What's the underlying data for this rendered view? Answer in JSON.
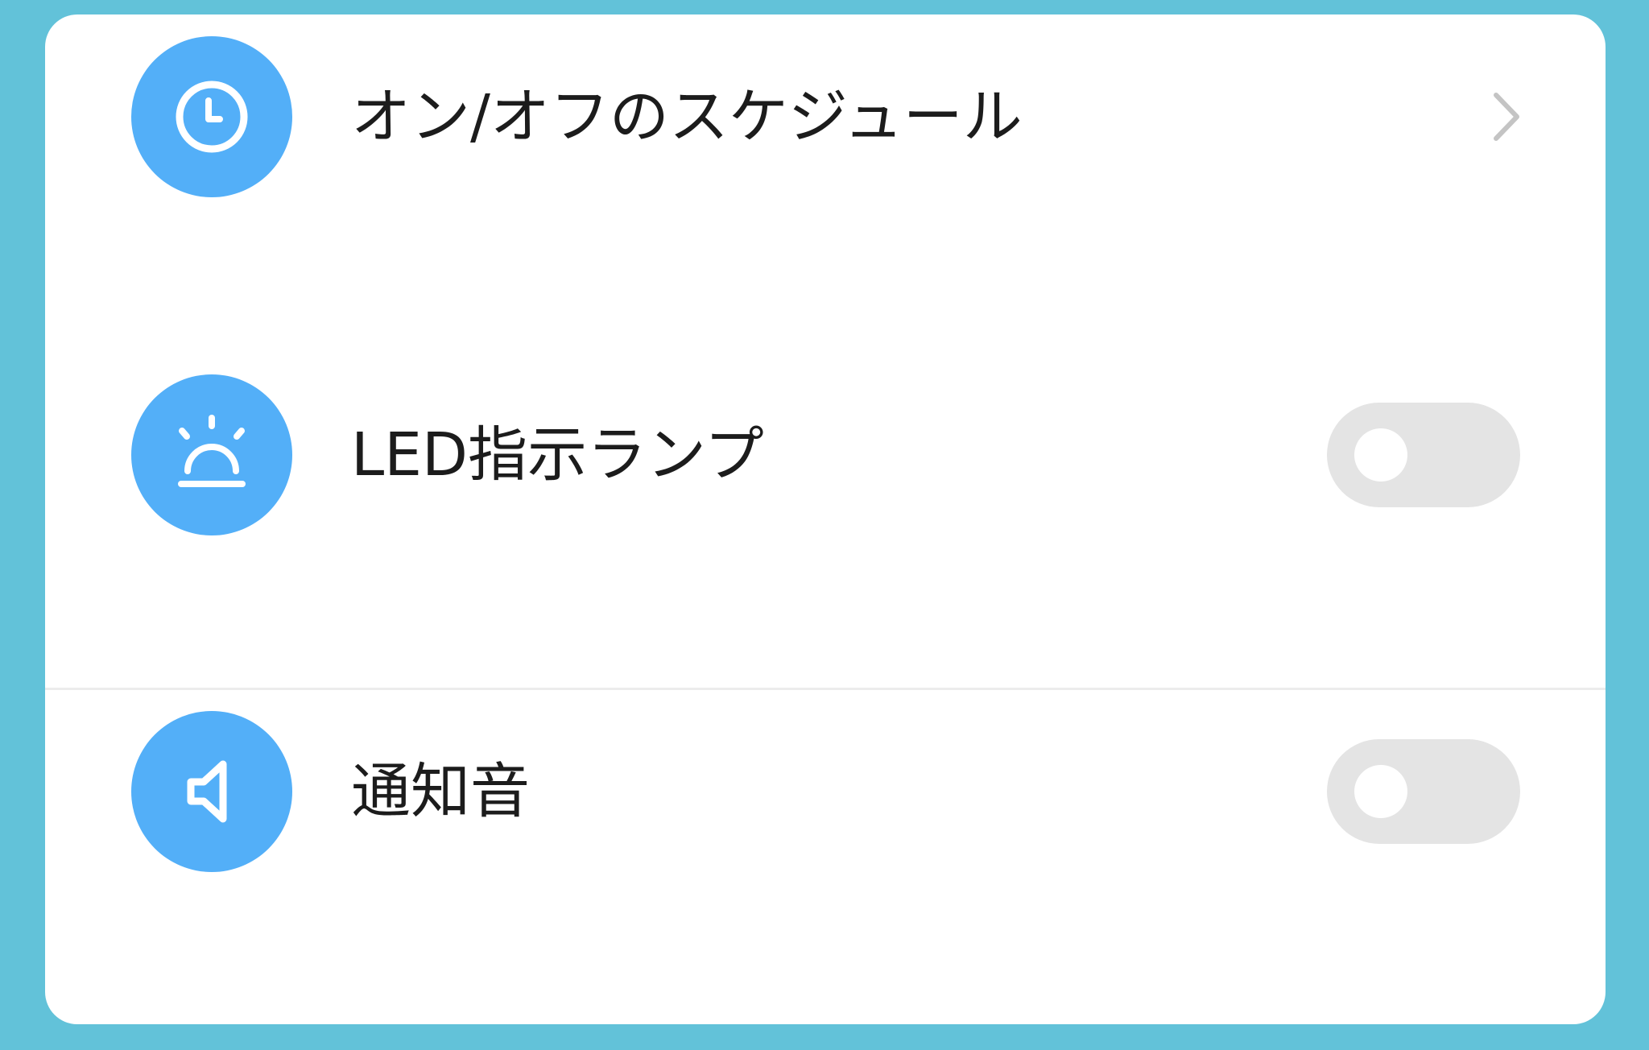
{
  "settings": {
    "schedule": {
      "label": "オン/オフのスケジュール",
      "icon": "clock-icon",
      "accessory": "chevron-right-icon"
    },
    "led": {
      "label": "LED指示ランプ",
      "icon": "alarm-lamp-icon",
      "enabled": false
    },
    "sound": {
      "label": "通知音",
      "icon": "speaker-icon",
      "enabled": false
    }
  },
  "colors": {
    "background": "#62c2d9",
    "card": "#ffffff",
    "icon_circle": "#53aff8",
    "toggle_off": "#e4e4e4",
    "divider": "#ececec",
    "chevron": "#c4c4c4"
  }
}
